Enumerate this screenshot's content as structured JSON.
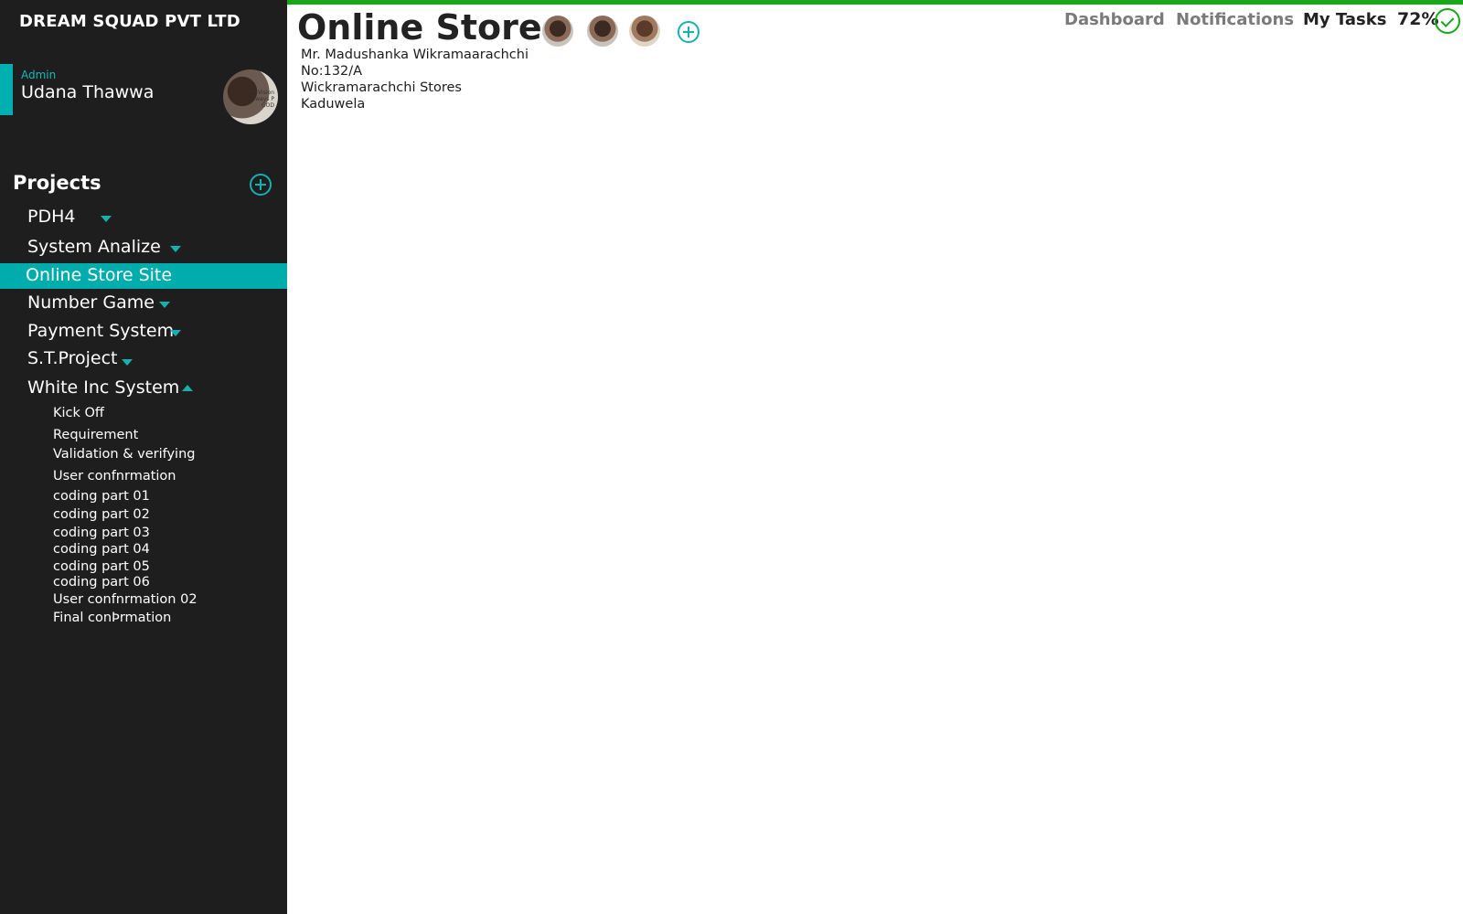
{
  "company": "DREAM SQUAD PVT LTD",
  "user": {
    "role": "Admin",
    "name": "Udana Thawwa",
    "avatar_text": "My Vision\nalways P\nGOD"
  },
  "projects_title": "Projects",
  "projects": [
    {
      "label": "PDH4",
      "state": "collapsed"
    },
    {
      "label": "System Analize",
      "state": "collapsed"
    },
    {
      "label": "Online Store Site",
      "state": "selected"
    },
    {
      "label": "Number Game",
      "state": "collapsed"
    },
    {
      "label": "Payment System",
      "state": "collapsed"
    },
    {
      "label": "S.T.Project",
      "state": "collapsed"
    },
    {
      "label": "White Inc System",
      "state": "expanded"
    }
  ],
  "subtasks": [
    "Kick Off",
    "Requirement",
    "Validation & verifying",
    "User confnrmation",
    "coding part 01",
    "coding part 02",
    "coding part 03",
    "coding part 04",
    "coding part 05",
    "coding part 06",
    "User confnrmation 02",
    "Final conÞrmation"
  ],
  "main": {
    "title": "Online Store",
    "address": [
      "Mr. Madushanka Wikramaarachchi",
      "No:132/A",
      "Wickramarachchi Stores",
      "Kaduwela"
    ]
  },
  "nav": {
    "dashboard": "Dashboard",
    "notifications": "Notifications",
    "my_tasks": "My Tasks"
  },
  "progress": "72%",
  "colors": {
    "accent": "#00adad",
    "success": "#17a717",
    "sidebar": "#1e1e1e"
  }
}
